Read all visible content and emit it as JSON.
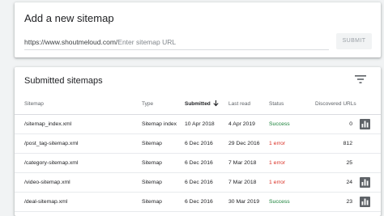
{
  "add_sitemap": {
    "title": "Add a new sitemap",
    "url_prefix": "https://www.shoutmeloud.com/",
    "input_placeholder": "Enter sitemap URL",
    "submit_label": "SUBMIT"
  },
  "submitted": {
    "title": "Submitted sitemaps",
    "filter_icon": "filter-icon",
    "columns": {
      "sitemap": "Sitemap",
      "type": "Type",
      "submitted": "Submitted",
      "last_read": "Last read",
      "status": "Status",
      "discovered": "Discovered URLs"
    },
    "sort_icon": "arrow-down-icon",
    "rows": [
      {
        "sitemap": "/sitemap_index.xml",
        "type": "Sitemap index",
        "submitted": "10 Apr 2018",
        "last_read": "4 Apr 2019",
        "status": "Success",
        "discovered": "0"
      },
      {
        "sitemap": "/post_tag-sitemap.xml",
        "type": "Sitemap",
        "submitted": "6 Dec 2016",
        "last_read": "29 Dec 2016",
        "status": "1 error",
        "discovered": "812"
      },
      {
        "sitemap": "/category-sitemap.xml",
        "type": "Sitemap",
        "submitted": "6 Dec 2016",
        "last_read": "7 Mar 2018",
        "status": "1 error",
        "discovered": "25"
      },
      {
        "sitemap": "/video-sitemap.xml",
        "type": "Sitemap",
        "submitted": "6 Dec 2016",
        "last_read": "7 Mar 2018",
        "status": "1 error",
        "discovered": "24"
      },
      {
        "sitemap": "/deal-sitemap.xml",
        "type": "Sitemap",
        "submitted": "6 Dec 2016",
        "last_read": "30 Mar 2019",
        "status": "Success",
        "discovered": "23"
      }
    ],
    "chart_icon": "bar-chart-icon"
  },
  "colors": {
    "success": "#188038",
    "error": "#d93025",
    "chart_icon": "#5f6368",
    "background": "#f1f3f4"
  }
}
